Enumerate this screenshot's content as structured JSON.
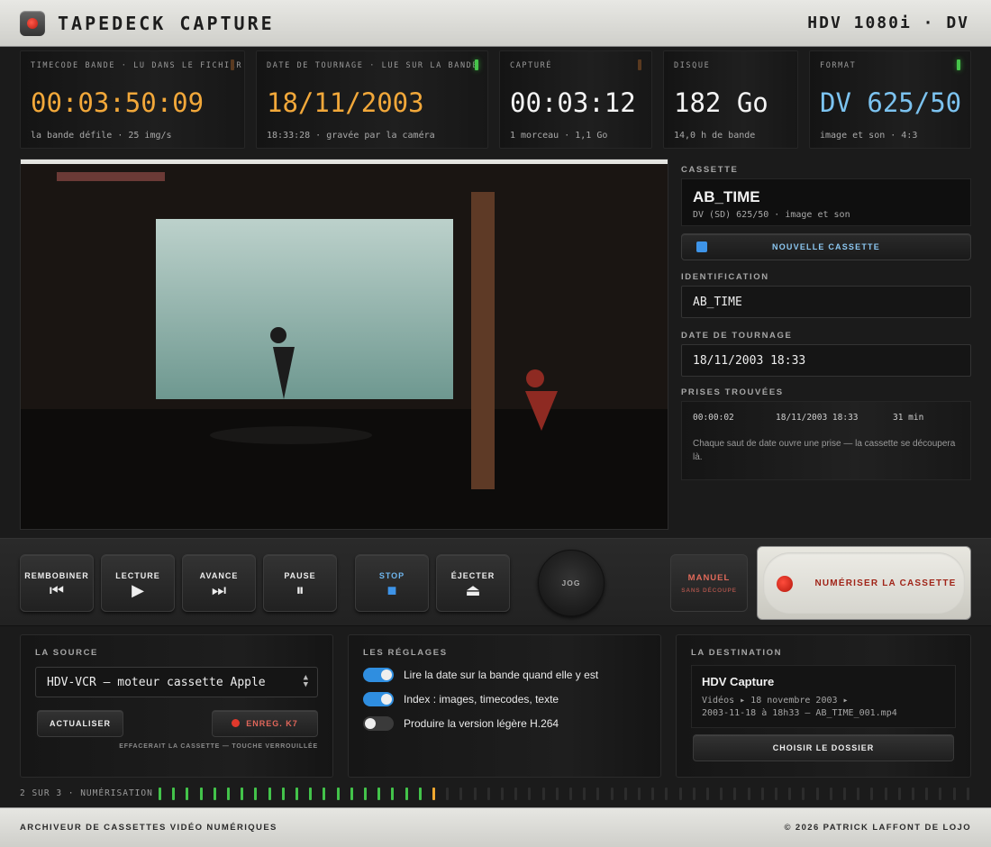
{
  "header": {
    "title": "TAPEDECK CAPTURE",
    "mode": "HDV 1080i · DV"
  },
  "cards": [
    {
      "label": "TIMECODE BANDE · LU DANS LE FICHIER",
      "value": "00:03:50:09",
      "sub": "la bande défile · 25 img/s",
      "color": "#f2a83a"
    },
    {
      "label": "DATE DE TOURNAGE · LUE SUR LA BANDE",
      "value": "18/11/2003",
      "sub": "18:33:28 · gravée par la caméra",
      "color": "#f2a83a"
    },
    {
      "label": "CAPTURÉ",
      "value": "00:03:12",
      "sub": "1 morceau · 1,1 Go",
      "color": "#f4f4f4"
    },
    {
      "label": "DISQUE",
      "value": "182 Go",
      "sub": "14,0 h de bande",
      "color": "#f4f4f4"
    },
    {
      "label": "FORMAT",
      "value": "DV 625/50",
      "sub": "image et son · 4:3",
      "color": "#7cc3f0"
    }
  ],
  "cassette": {
    "section_label": "CASSETTE",
    "name": "AB_TIME",
    "desc": "DV (SD) 625/50 · image et son",
    "new_button": "NOUVELLE CASSETTE"
  },
  "identification": {
    "label": "IDENTIFICATION",
    "value": "AB_TIME"
  },
  "shoot_date": {
    "label": "DATE DE TOURNAGE",
    "value": "18/11/2003 18:33"
  },
  "takes": {
    "label": "PRISES TROUVÉES",
    "row": {
      "timecode": "00:00:02",
      "date": "18/11/2003 18:33",
      "duration": "31 min"
    },
    "note": "Chaque saut de date ouvre une prise — la cassette se découpera là."
  },
  "transport": {
    "rewind": {
      "label": "REMBOBINER",
      "icon": "⏮"
    },
    "play": {
      "label": "LECTURE",
      "icon": "▶"
    },
    "forward": {
      "label": "AVANCE",
      "icon": "⏭"
    },
    "pause": {
      "label": "PAUSE",
      "icon": "⏸"
    },
    "stop": {
      "label": "STOP",
      "icon": "■"
    },
    "eject": {
      "label": "ÉJECTER",
      "icon": "⏏"
    },
    "jog": "JOG",
    "manual": "MANUEL",
    "manual_sub": "SANS DÉCOUPE",
    "digitize": "NUMÉRISER LA CASSETTE",
    "stop_color": "#3e94e8",
    "record_color": "#e0392c"
  },
  "source": {
    "title": "LA SOURCE",
    "device": "HDV-VCR — moteur cassette Apple",
    "refresh": "ACTUALISER",
    "record": "ENREG. K7",
    "warning": "EFFACERAIT LA CASSETTE — TOUCHE VERROUILLÉE"
  },
  "settings": {
    "title": "LES RÉGLAGES",
    "options": [
      {
        "label": "Lire la date sur la bande quand elle y est",
        "on": true
      },
      {
        "label": "Index : images, timecodes, texte",
        "on": true
      },
      {
        "label": "Produire la version légère H.264",
        "on": false
      }
    ]
  },
  "destination": {
    "title": "LA DESTINATION",
    "name": "HDV Capture",
    "path": "Vidéos ▸ 18 novembre 2003 ▸\n2003-11-18 à 18h33 — AB_TIME_001.mp4",
    "button": "CHOISIR LE DOSSIER"
  },
  "progress": {
    "label": "2 SUR 3 · NUMÉRISATION",
    "total_ticks": 60,
    "done_ticks": 20,
    "current_tick": 20
  },
  "footer": {
    "left": "ARCHIVEUR DE CASSETTES VIDÉO NUMÉRIQUES",
    "right": "© 2026 PATRICK LAFFONT DE LOJO"
  }
}
